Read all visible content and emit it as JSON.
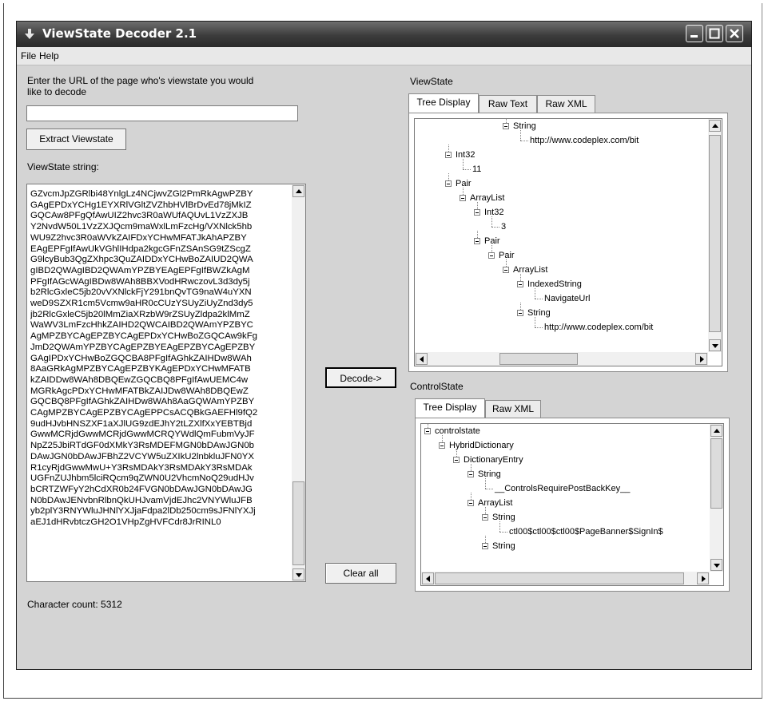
{
  "window": {
    "title": "ViewState Decoder 2.1"
  },
  "menu": {
    "file": "File",
    "help": "Help"
  },
  "left": {
    "url_prompt_line1": "Enter the URL of the page who's viewstate you would",
    "url_prompt_line2": "like to decode",
    "url_value": "",
    "extract_button": "Extract Viewstate",
    "viewstate_string_label": "ViewState string:",
    "viewstate_lines": [
      "GZvcmJpZGRlbi48YnlgLz4NCjwvZGl2PmRkAgwPZBY",
      "GAgEPDxYCHg1EYXRlVGltZVZhbHVlBrDvEd78jMkIZ",
      "GQCAw8PFgQfAwUIZ2hvc3R0aWUfAQUvL1VzZXJB",
      "Y2NvdW50L1VzZXJQcm9maWxlLmFzcHg/VXNlck5hb",
      "WU9Z2hvc3R0aWVkZAIFDxYCHwMFATJkAhAPZBY",
      "EAgEPFgIfAwUkVGhlIHdpa2kgcGFnZSAnSG9tZScgZ",
      "G9lcyBub3QgZXhpc3QuZAIDDxYCHwBoZAIUD2QWA",
      "gIBD2QWAgIBD2QWAmYPZBYEAgEPFgIfBWZkAgM",
      "PFgIfAGcWAgIBDw8WAh8BBXVodHRwczovL3d3dy5j",
      "b2RlcGxleC5jb20vVXNlckFjY291bnQvTG9naW4uYXN",
      "weD9SZXR1cm5Vcmw9aHR0cCUzYSUyZiUyZnd3dy5",
      "jb2RlcGxleC5jb20lMmZiaXRzbW9rZSUyZldpa2klMmZ",
      "WaWV3LmFzcHhkZAIHD2QWCAIBD2QWAmYPZBYC",
      "AgMPZBYCAgEPZBYCAgEPDxYCHwBoZGQCAw9kFg",
      "JmD2QWAmYPZBYCAgEPZBYEAgEPZBYCAgEPZBY",
      "GAgIPDxYCHwBoZGQCBA8PFgIfAGhkZAIHDw8WAh",
      "8AaGRkAgMPZBYCAgEPZBYKAgEPDxYCHwMFATB",
      "kZAIDDw8WAh8DBQEwZGQCBQ8PFgIfAwUEMC4w",
      "MGRkAgcPDxYCHwMFATBkZAIJDw8WAh8DBQEwZ",
      "GQCBQ8PFgIfAGhkZAIHDw8WAh8AaGQWAmYPZBY",
      "CAgMPZBYCAgEPZBYCAgEPPCsACQBkGAEFHl9fQ2",
      "9udHJvbHNSZXF1aXJlUG9zdEJhY2tLZXlfXxYEBTBjd",
      "GwwMCRjdGwwMCRjdGwwMCRQYWdlQmFubmVyJF",
      "NpZ25JbiRTdGF0dXMkY3RsMDEFMGN0bDAwJGN0b",
      "DAwJGN0bDAwJFBhZ2VCYW5uZXIkU2lnbkluJFN0YX",
      "R1cyRjdGwwMwU+Y3RsMDAkY3RsMDAkY3RsMDAk",
      "UGFnZUJhbm5lciRQcm9qZWN0U2VhcmNoQ29udHJv",
      "bCRTZWFyY2hCdXR0b24FVGN0bDAwJGN0bDAwJG",
      "N0bDAwJENvbnRlbnQkUHJvamVjdEJhc2VNYWluJFB",
      "yb2plY3RNYWluJHNlYXJjaFdpa2lDb250cm9sJFNlYXJj",
      "aEJ1dHRvbtczGH2O1VHpZgHVFCdr8JrRINL0"
    ],
    "character_count_label": "Character count: 5312"
  },
  "middle": {
    "decode_button": "Decode->",
    "clear_button": "Clear all"
  },
  "viewstate_panel": {
    "label": "ViewState",
    "tabs": [
      "Tree Display",
      "Raw Text",
      "Raw XML"
    ],
    "active_tab": "Tree Display",
    "nodes": [
      {
        "text": "String",
        "level": 4,
        "expander": true
      },
      {
        "text": "http://www.codeplex.com/bit",
        "level": 5,
        "expander": false
      },
      {
        "text": "Int32",
        "level": 0,
        "expander": true
      },
      {
        "text": "11",
        "level": 1,
        "expander": false
      },
      {
        "text": "Pair",
        "level": 0,
        "expander": true
      },
      {
        "text": "ArrayList",
        "level": 1,
        "expander": true
      },
      {
        "text": "Int32",
        "level": 2,
        "expander": true
      },
      {
        "text": "3",
        "level": 3,
        "expander": false
      },
      {
        "text": "Pair",
        "level": 2,
        "expander": true
      },
      {
        "text": "Pair",
        "level": 3,
        "expander": true
      },
      {
        "text": "ArrayList",
        "level": 4,
        "expander": true
      },
      {
        "text": "IndexedString",
        "level": 5,
        "expander": true
      },
      {
        "text": "NavigateUrl",
        "level": 6,
        "expander": false
      },
      {
        "text": "String",
        "level": 5,
        "expander": true
      },
      {
        "text": "http://www.codeplex.com/bit",
        "level": 6,
        "expander": false
      }
    ]
  },
  "controlstate_panel": {
    "label": "ControlState",
    "tabs": [
      "Tree Display",
      "Raw XML"
    ],
    "active_tab": "Tree Display",
    "nodes": [
      {
        "text": "controlstate",
        "level": 0,
        "expander": true
      },
      {
        "text": "HybridDictionary",
        "level": 1,
        "expander": true
      },
      {
        "text": "DictionaryEntry",
        "level": 2,
        "expander": true
      },
      {
        "text": "String",
        "level": 3,
        "expander": true
      },
      {
        "text": "__ControlsRequirePostBackKey__",
        "level": 4,
        "expander": false
      },
      {
        "text": "ArrayList",
        "level": 3,
        "expander": true
      },
      {
        "text": "String",
        "level": 4,
        "expander": true
      },
      {
        "text": "ctl00$ctl00$ctl00$PageBanner$SignIn$",
        "level": 5,
        "expander": false
      },
      {
        "text": "String",
        "level": 4,
        "expander": true
      }
    ]
  },
  "icons": {
    "app": "down-arrow-icon",
    "minimize": "minimize-icon",
    "maximize": "maximize-icon",
    "close": "close-icon",
    "scroll_up": "scroll-up-arrow-icon",
    "scroll_down": "scroll-down-arrow-icon",
    "scroll_left": "scroll-left-arrow-icon",
    "scroll_right": "scroll-right-arrow-icon"
  },
  "colors": {
    "titlebar": "#3c3c3c",
    "window_bg": "#d4d4d4",
    "field_bg": "#ffffff"
  }
}
